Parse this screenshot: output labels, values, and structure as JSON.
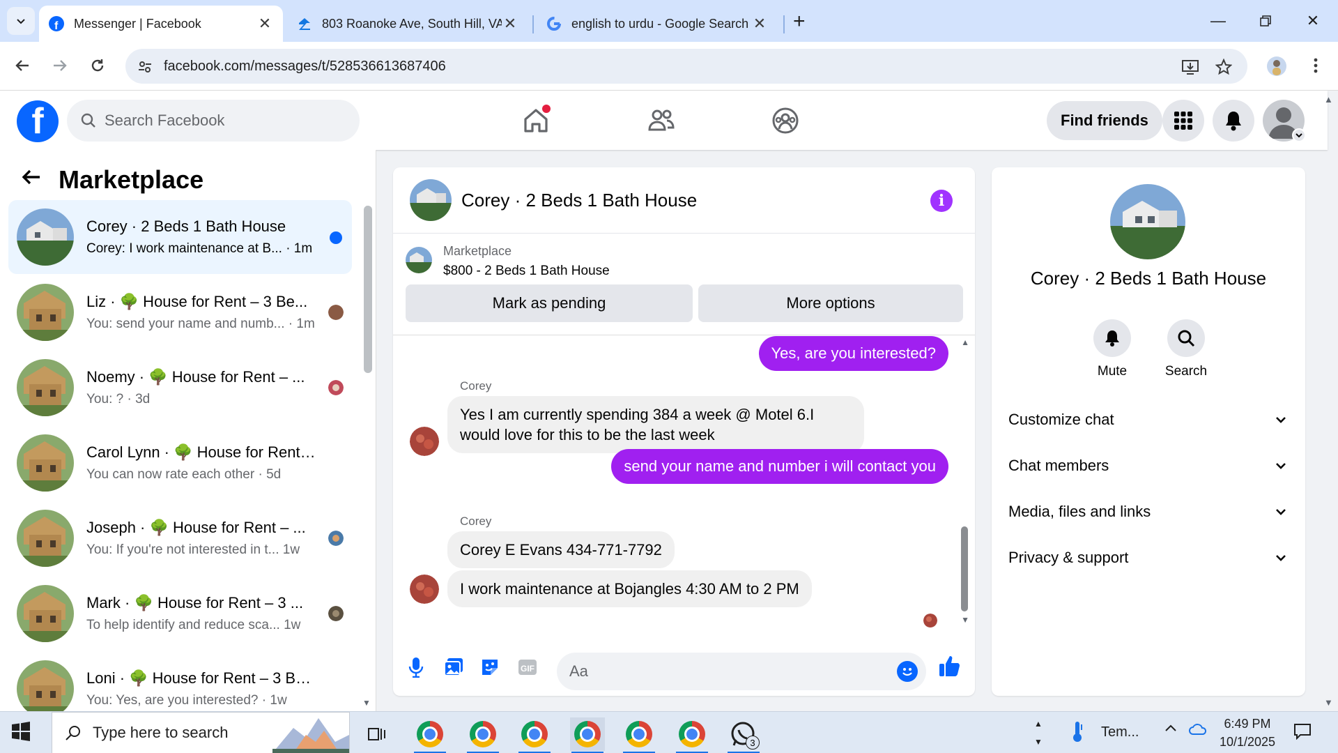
{
  "browser": {
    "tabs": [
      {
        "title": "Messenger | Facebook",
        "active": true
      },
      {
        "title": "803 Roanoke Ave, South Hill, VA",
        "active": false
      },
      {
        "title": "english to urdu - Google Search",
        "active": false
      }
    ],
    "url": "facebook.com/messages/t/528536613687406"
  },
  "fb": {
    "search_placeholder": "Search Facebook",
    "find_friends": "Find friends"
  },
  "left": {
    "title": "Marketplace",
    "conversations": [
      {
        "name": "Corey · 2 Beds 1 Bath House",
        "preview": "Corey: I work maintenance at B...",
        "time": "· 1m",
        "unread": true
      },
      {
        "name": "Liz · 🌳 House for Rent – 3 Be...",
        "preview": "You: send your name and numb...",
        "time": "· 1m"
      },
      {
        "name": "Noemy · 🌳 House for Rent – ...",
        "preview": "You: ?",
        "time": "· 3d"
      },
      {
        "name": "Carol Lynn · 🌳 House for Rent –...",
        "preview": "You can now rate each other",
        "time": "· 5d"
      },
      {
        "name": "Joseph · 🌳 House for Rent – ...",
        "preview": "You: If you're not interested in t...",
        "time": "1w"
      },
      {
        "name": "Mark · 🌳 House for Rent – 3 ...",
        "preview": "To help identify and reduce sca...",
        "time": "1w"
      },
      {
        "name": "Loni · 🌳 House for Rent – 3 Bed...",
        "preview": "You: Yes, are you interested?",
        "time": "· 1w"
      }
    ]
  },
  "chat": {
    "title": "Corey · 2 Beds 1 Bath House",
    "listing_label": "Marketplace",
    "listing_title": "$800 - 2 Beds 1 Bath House",
    "mark_pending": "Mark as pending",
    "more_options": "More options",
    "messages": {
      "m1": "Yes, are you interested?",
      "sender1": "Corey",
      "m2": "Yes I am currently spending 384 a week @ Motel 6.I would love for this to be the last week",
      "m3": "send your name and number i will contact you",
      "sender2": "Corey",
      "m4": "Corey E Evans 434-771-7792",
      "m5": "I work maintenance at Bojangles 4:30 AM to 2 PM"
    },
    "composer_placeholder": "Aa"
  },
  "info": {
    "name": "Corey · 2 Beds 1 Bath House",
    "mute": "Mute",
    "search": "Search",
    "sections": [
      "Customize chat",
      "Chat members",
      "Media, files and links",
      "Privacy & support"
    ]
  },
  "taskbar": {
    "search_placeholder": "Type here to search",
    "weather": "Tem...",
    "whatsapp_badge": "3",
    "time": "6:49 PM",
    "date": "10/1/2025"
  }
}
